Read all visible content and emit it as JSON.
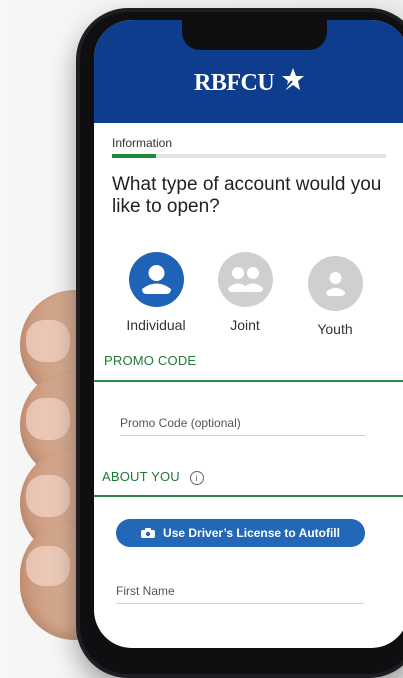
{
  "header": {
    "brand": "RBFCU"
  },
  "steps": {
    "current": "Information",
    "progress_fraction": 0.16
  },
  "question": "What type of account would you like to open?",
  "account_types": [
    {
      "label": "Individual",
      "selected": true
    },
    {
      "label": "Joint",
      "selected": false
    },
    {
      "label": "Youth",
      "selected": false
    }
  ],
  "promo": {
    "title": "PROMO CODE",
    "placeholder": "Promo Code (optional)"
  },
  "about": {
    "title": "ABOUT YOU",
    "autofill_button": "Use Driver’s License to Autofill",
    "first_name_placeholder": "First Name"
  },
  "colors": {
    "header_blue": "#0d3d8c",
    "selected_blue": "#1e63b6",
    "accent_green": "#1f7a34",
    "button_blue": "#2367b8"
  },
  "icons": [
    "brand-star-icon",
    "user-icon",
    "users-icon",
    "child-icon",
    "info-icon",
    "camera-icon"
  ]
}
